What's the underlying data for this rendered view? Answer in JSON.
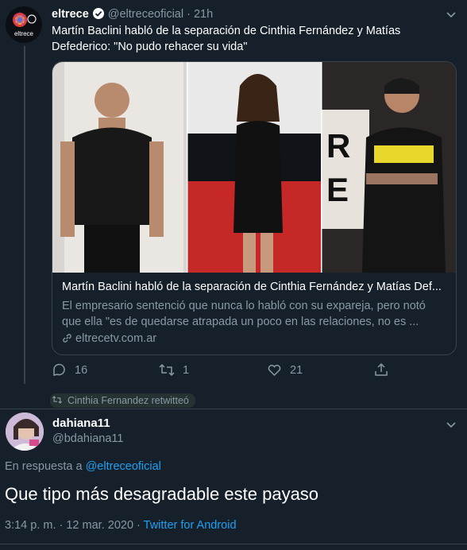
{
  "tweet": {
    "author_name": "eltrece",
    "author_handle": "@eltreceoficial",
    "separator": "·",
    "time": "21h",
    "avatar_label": "eltrece",
    "text": "Martín Baclini habló de la separación de Cinthia Fernández y Matías Defederico: \"No pudo rehacer su vida\"",
    "card": {
      "title": "Martín Baclini habló de la separación de Cinthia Fernández y Matías Def...",
      "description": "El empresario sentenció que nunca lo habló con su expareja, pero notó que ella \"es de quedarse atrapada un poco en las relaciones, no es ...",
      "link": "eltrecetv.com.ar"
    },
    "actions": {
      "replies": "16",
      "retweets": "1",
      "likes": "21"
    }
  },
  "retweet_notice": "Cinthia Fernandez retwitteó",
  "reply_tweet": {
    "author_name": "dahiana11",
    "author_handle": "@bdahiana11",
    "reply_prefix": "En respuesta a",
    "reply_to": "@eltreceoficial",
    "text": "Que tipo más desagradable este payaso",
    "timestamp": "3:14 p. m. · 12 mar. 2020 ·",
    "source": "Twitter for Android"
  },
  "colors": {
    "background": "#15202b",
    "secondary_text": "#8899a6",
    "accent": "#1da1f2",
    "border": "#38444d"
  },
  "icons": [
    "verified-icon",
    "chevron-down-icon",
    "reply-icon",
    "retweet-icon",
    "like-icon",
    "share-icon",
    "link-icon"
  ]
}
